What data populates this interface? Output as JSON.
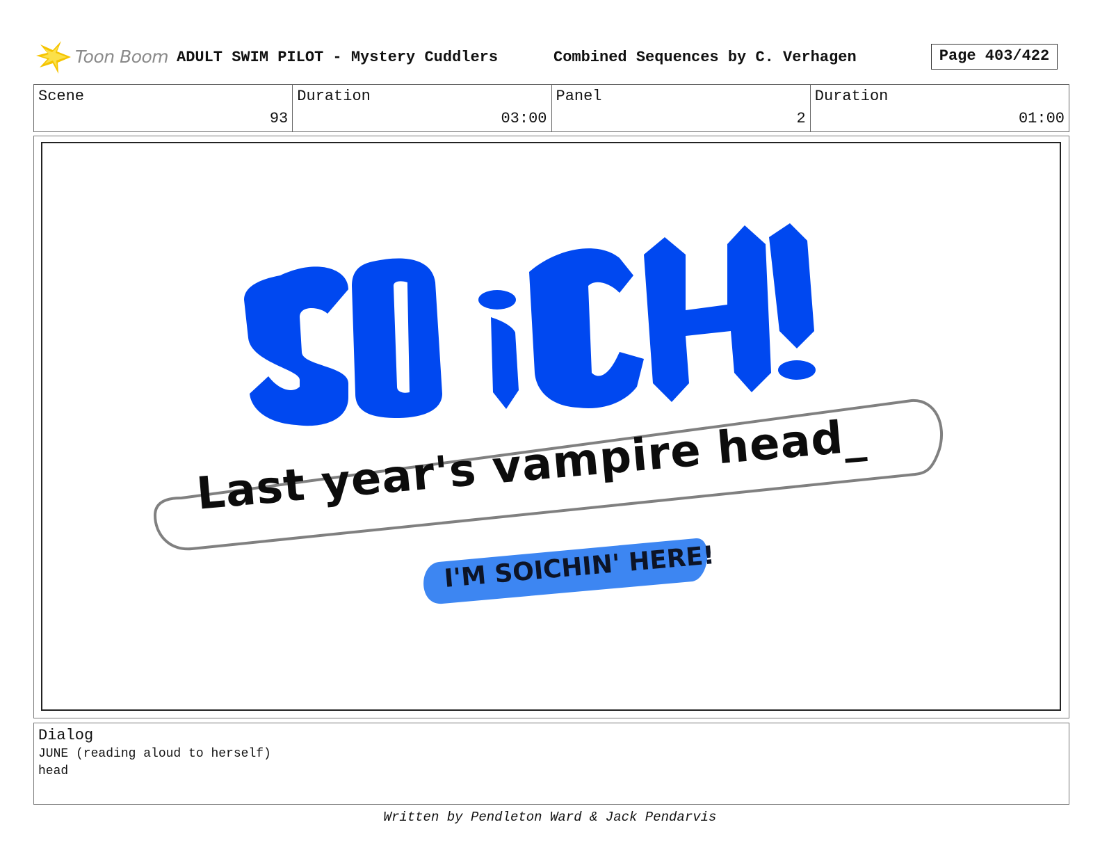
{
  "header": {
    "logo_text": "Toon Boom",
    "project_title": "ADULT SWIM PILOT - Mystery Cuddlers",
    "sequence_title": "Combined Sequences by C. Verhagen",
    "page_label": "Page 403/422"
  },
  "info": [
    {
      "label": "Scene",
      "value": "93"
    },
    {
      "label": "Duration",
      "value": "03:00"
    },
    {
      "label": "Panel",
      "value": "2"
    },
    {
      "label": "Duration",
      "value": "01:00"
    }
  ],
  "panel": {
    "logo_word": "SOiCH!",
    "search_text": "Last year's vampire head_",
    "badge_text": "I'M SOICHIN' HERE!",
    "colors": {
      "logo_blue": "#0048f0",
      "badge_blue": "#3d86f2",
      "search_border": "#808080"
    }
  },
  "dialog": {
    "title": "Dialog",
    "lines": [
      "JUNE (reading aloud to herself)",
      "head"
    ]
  },
  "footer": {
    "credit": "Written by Pendleton Ward & Jack Pendarvis"
  }
}
